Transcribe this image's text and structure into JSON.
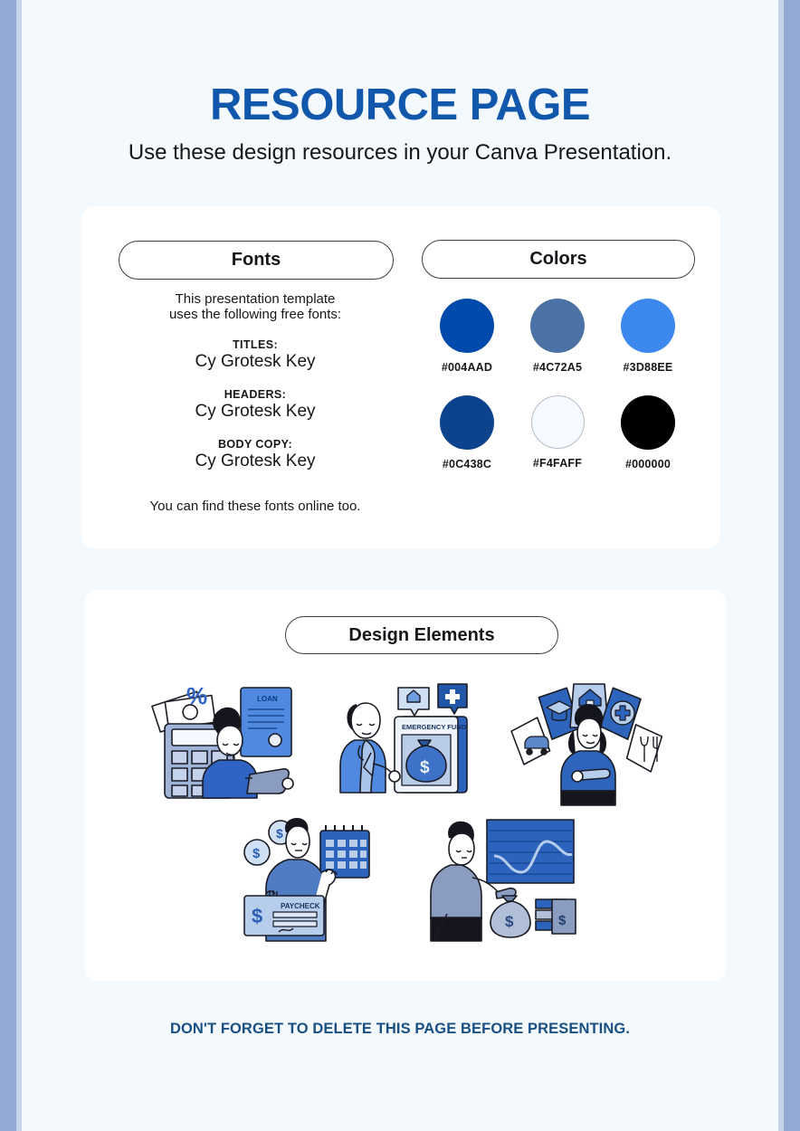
{
  "page": {
    "title": "RESOURCE PAGE",
    "subtitle": "Use these design resources in your Canva Presentation.",
    "footer_note": "DON'T FORGET TO DELETE THIS PAGE BEFORE PRESENTING.",
    "background": "#f4f9fd",
    "edge_color": "#92aad4",
    "title_color": "#1157ab",
    "footer_color": "#184f82"
  },
  "fonts_section": {
    "heading": "Fonts",
    "intro_line_1": "This presentation template",
    "intro_line_2": "uses the following free fonts:",
    "groups": [
      {
        "label": "TITLES:",
        "font": "Cy Grotesk Key"
      },
      {
        "label": "HEADERS:",
        "font": "Cy Grotesk Key"
      },
      {
        "label": "BODY COPY:",
        "font": "Cy Grotesk Key"
      }
    ],
    "outro": "You can find these fonts online too."
  },
  "colors_section": {
    "heading": "Colors",
    "swatches": [
      {
        "hex": "#004AAD",
        "label": "#004AAD",
        "bordered": false
      },
      {
        "hex": "#4C72A5",
        "label": "#4C72A5",
        "bordered": false
      },
      {
        "hex": "#3D88EE",
        "label": "#3D88EE",
        "bordered": false
      },
      {
        "hex": "#0C438C",
        "label": "#0C438C",
        "bordered": false
      },
      {
        "hex": "#F4FAFF",
        "label": "#F4FAFF",
        "bordered": true
      },
      {
        "hex": "#000000",
        "label": "#000000",
        "bordered": false
      }
    ]
  },
  "design_elements_section": {
    "heading": "Design Elements",
    "illustrations": [
      {
        "name": "loan-calculator-illustration",
        "caption_text": "LOAN"
      },
      {
        "name": "emergency-fund-illustration",
        "caption_text": "EMERGENCY FUND"
      },
      {
        "name": "budget-categories-illustration",
        "caption_text": ""
      },
      {
        "name": "paycheck-calendar-illustration",
        "caption_text": "PAYCHECK"
      },
      {
        "name": "growth-chart-savings-illustration",
        "caption_text": ""
      }
    ]
  }
}
